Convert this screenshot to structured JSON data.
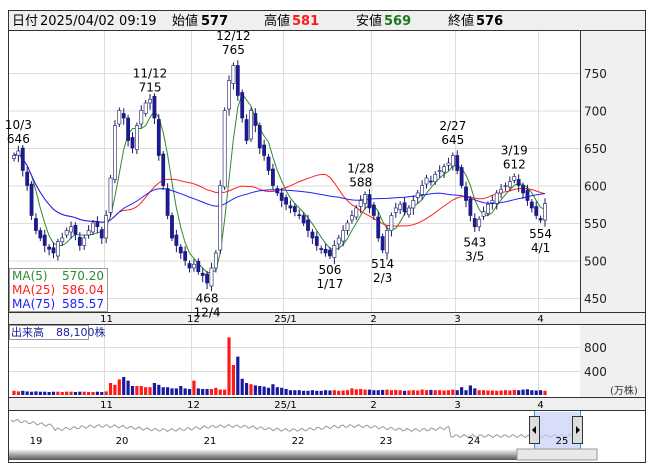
{
  "header": {
    "date_label": "日付",
    "datetime": "2025/04/02 09:19",
    "open_label": "始値",
    "open": "577",
    "high_label": "高値",
    "high": "581",
    "low_label": "安値",
    "low": "569",
    "close_label": "終値",
    "close": "576"
  },
  "legend": [
    {
      "label": "MA(5)",
      "value": "570.20",
      "color": "#2e8b2e"
    },
    {
      "label": "MA(25)",
      "value": "586.04",
      "color": "#ff2020"
    },
    {
      "label": "MA(75)",
      "value": "585.57",
      "color": "#2020ff"
    }
  ],
  "volume_legend": {
    "label": "出来高",
    "value": "88,100株"
  },
  "volume_unit": "(万株)",
  "overview_years": [
    "19",
    "20",
    "21",
    "22",
    "23",
    "24",
    "25"
  ],
  "chart_data": {
    "type": "candlestick",
    "price_ticks": [
      450,
      500,
      550,
      600,
      650,
      700,
      750
    ],
    "price_range": [
      430,
      785
    ],
    "volume_ticks": [
      400,
      800
    ],
    "volume_range": [
      0,
      1200
    ],
    "month_labels": [
      {
        "label": "11",
        "index": 22
      },
      {
        "label": "12",
        "index": 42
      },
      {
        "label": "25/1",
        "index": 63
      },
      {
        "label": "2",
        "index": 83
      },
      {
        "label": "3",
        "index": 102
      },
      {
        "label": "4",
        "index": 121
      }
    ],
    "closes": [
      640,
      646,
      620,
      600,
      560,
      540,
      530,
      520,
      515,
      510,
      525,
      530,
      540,
      545,
      535,
      520,
      530,
      540,
      550,
      545,
      530,
      560,
      610,
      680,
      700,
      690,
      660,
      650,
      680,
      700,
      710,
      715,
      690,
      640,
      600,
      560,
      530,
      520,
      510,
      500,
      490,
      495,
      485,
      480,
      470,
      490,
      510,
      600,
      700,
      740,
      760,
      720,
      690,
      660,
      700,
      680,
      650,
      640,
      620,
      600,
      590,
      580,
      575,
      570,
      565,
      560,
      550,
      540,
      530,
      520,
      515,
      510,
      506,
      520,
      530,
      540,
      550,
      560,
      570,
      580,
      588,
      570,
      560,
      530,
      514,
      540,
      560,
      570,
      575,
      565,
      570,
      580,
      590,
      600,
      610,
      605,
      615,
      620,
      625,
      630,
      640,
      620,
      600,
      580,
      560,
      545,
      555,
      565,
      575,
      580,
      590,
      595,
      600,
      605,
      612,
      600,
      590,
      580,
      570,
      560,
      554,
      576
    ],
    "volumes": [
      70,
      60,
      70,
      60,
      55,
      60,
      55,
      55,
      50,
      55,
      55,
      50,
      55,
      55,
      50,
      55,
      55,
      50,
      50,
      55,
      50,
      60,
      200,
      170,
      260,
      300,
      240,
      150,
      150,
      150,
      130,
      130,
      200,
      170,
      130,
      130,
      110,
      110,
      150,
      110,
      100,
      240,
      110,
      100,
      100,
      100,
      120,
      90,
      90,
      960,
      500,
      640,
      270,
      200,
      180,
      160,
      150,
      140,
      120,
      180,
      130,
      120,
      100,
      80,
      80,
      80,
      70,
      70,
      80,
      70,
      70,
      80,
      75,
      80,
      70,
      75,
      80,
      110,
      95,
      100,
      90,
      90,
      80,
      80,
      85,
      90,
      80,
      85,
      80,
      70,
      75,
      80,
      75,
      90,
      80,
      85,
      80,
      80,
      75,
      80,
      90,
      80,
      130,
      80,
      160,
      110,
      80,
      80,
      75,
      75,
      70,
      75,
      80,
      75,
      85,
      80,
      90,
      95,
      80,
      75,
      80,
      70
    ],
    "annotations": [
      {
        "date": "10/3",
        "price": "646",
        "index": 1,
        "pos": "above"
      },
      {
        "date": "11/12",
        "price": "715",
        "index": 31,
        "pos": "above"
      },
      {
        "date": "12/4",
        "price": "468",
        "index": 44,
        "pos": "below"
      },
      {
        "date": "12/12",
        "price": "765",
        "index": 50,
        "pos": "above"
      },
      {
        "date": "1/17",
        "price": "506",
        "index": 72,
        "pos": "below"
      },
      {
        "date": "1/28",
        "price": "588",
        "index": 79,
        "pos": "above"
      },
      {
        "date": "2/3",
        "price": "514",
        "index": 84,
        "pos": "below"
      },
      {
        "date": "2/27",
        "price": "645",
        "index": 100,
        "pos": "above"
      },
      {
        "date": "3/5",
        "price": "543",
        "index": 105,
        "pos": "below"
      },
      {
        "date": "3/19",
        "price": "612",
        "index": 114,
        "pos": "above"
      },
      {
        "date": "4/1",
        "price": "554",
        "index": 120,
        "pos": "below"
      }
    ],
    "up_color": "#ffffff",
    "down_color": "#1a1aa0",
    "volume_up": "#ff1a1a",
    "volume_down": "#1a1aa0"
  }
}
